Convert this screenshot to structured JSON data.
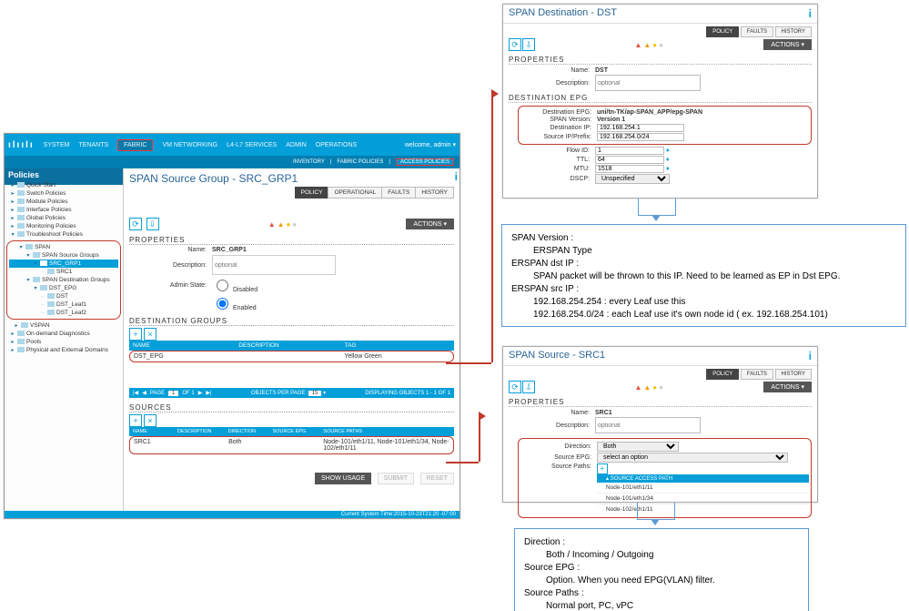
{
  "nav": {
    "system": "SYSTEM",
    "tenants": "TENANTS",
    "fabric": "FABRIC",
    "vm": "VM NETWORKING",
    "l4l7": "L4-L7 SERVICES",
    "admin": "ADMIN",
    "ops": "OPERATIONS",
    "user": "welcome, admin ▾"
  },
  "subnav": {
    "inv": "INVENTORY",
    "fp": "FABRIC POLICIES",
    "ap": "ACCESS POLICIES"
  },
  "tree": {
    "hdr": "Policies",
    "items": [
      "Quick Start",
      "Switch Policies",
      "Module Policies",
      "Interface Policies",
      "Global Policies",
      "Monitoring Policies",
      "Troubleshoot Policies"
    ],
    "span": "SPAN",
    "ssg": "SPAN Source Groups",
    "srcgrp": "SRC_GRP1",
    "src1": "SRC1",
    "sdg": "SPAN Destination Groups",
    "dstepg": "DST_EPG",
    "dst": "DST",
    "dstl1": "DST_Leaf1",
    "dstl2": "DST_Leaf2",
    "vspan": "VSPAN",
    "ond": "On-demand Diagnostics",
    "pools": "Pools",
    "phys": "Physical and External Domains"
  },
  "main": {
    "title": "SPAN Source Group - SRC_GRP1",
    "tabs": {
      "policy": "POLICY",
      "oper": "OPERATIONAL",
      "faults": "FAULTS",
      "history": "HISTORY"
    },
    "actions": "ACTIONS ▾",
    "props_hdr": "PROPERTIES",
    "name_lbl": "Name:",
    "name_val": "SRC_GRP1",
    "desc_lbl": "Description:",
    "desc_ph": "optional",
    "admin_lbl": "Admin State:",
    "admin_dis": "Disabled",
    "admin_en": "Enabled",
    "dest_hdr": "DESTINATION GROUPS",
    "dest_cols": {
      "name": "NAME",
      "desc": "DESCRIPTION",
      "tag": "TAG"
    },
    "dest_row": {
      "name": "DST_EPG",
      "tag": "Yellow Green"
    },
    "pager": {
      "page_lbl": "PAGE",
      "page": "1",
      "of": "OF 1",
      "opp": "OBJECTS PER PAGE:",
      "oppv": "15",
      "disp": "DISPLAYING OBJECTS 1 - 1 OF 1"
    },
    "src_hdr": "SOURCES",
    "src_cols": {
      "name": "NAME",
      "desc": "DESCRIPTION",
      "dir": "DIRECTION",
      "sepg": "SOURCE EPG",
      "paths": "SOURCE PATHS"
    },
    "src_row": {
      "name": "SRC1",
      "dir": "Both",
      "paths": "Node-101/eth1/11, Node-101/eth1/34, Node-102/eth1/11"
    },
    "show": "SHOW USAGE",
    "submit": "SUBMIT",
    "reset": "RESET",
    "systime": "Current System Time:2015-10-23T21:20 -07:00"
  },
  "dst": {
    "title": "SPAN Destination - DST",
    "tabs": {
      "policy": "POLICY",
      "faults": "FAULTS",
      "history": "HISTORY"
    },
    "actions": "ACTIONS ▾",
    "props": "PROPERTIES",
    "name_lbl": "Name:",
    "name_val": "DST",
    "desc_lbl": "Description:",
    "desc_ph": "optional",
    "depg_hdr": "DESTINATION EPG",
    "depg_lbl": "Destination EPG:",
    "depg_val": "uni/tn-TK/ap-SPAN_APP/epg-SPAN",
    "ver_lbl": "SPAN Version:",
    "ver_val": "Version 1",
    "dip_lbl": "Destination IP:",
    "dip_val": "192.168.254.1",
    "sip_lbl": "Source IP/Prefix:",
    "sip_val": "192.168.254.0/24",
    "flow_lbl": "Flow ID:",
    "flow_val": "1",
    "ttl_lbl": "TTL:",
    "ttl_val": "64",
    "mtu_lbl": "MTU:",
    "mtu_val": "1518",
    "dscp_lbl": "DSCP:",
    "dscp_val": "Unspecified"
  },
  "src": {
    "title": "SPAN Source - SRC1",
    "tabs": {
      "policy": "POLICY",
      "faults": "FAULTS",
      "history": "HISTORY"
    },
    "actions": "ACTIONS ▾",
    "props": "PROPERTIES",
    "name_lbl": "Name:",
    "name_val": "SRC1",
    "desc_lbl": "Description:",
    "desc_ph": "optional",
    "dir_lbl": "Direction:",
    "dir_val": "Both",
    "sepg_lbl": "Source EPG:",
    "sepg_val": "select an option",
    "sap_lbl": "Source Paths:",
    "sap_hdr": "SOURCE ACCESS PATH",
    "paths": [
      "Node-101/eth1/11",
      "Node-101/eth1/34",
      "Node-102/eth1/11"
    ]
  },
  "exp1": {
    "l1": "SPAN Version :",
    "l2": "ERSPAN Type",
    "l3": "ERSPAN dst IP :",
    "l4": "SPAN packet will be thrown to this IP. Need to be learned as EP in Dst EPG.",
    "l5": "ERSPAN src IP :",
    "l6": "192.168.254.254 : every Leaf use this",
    "l7": "192.168.254.0/24 : each Leaf use it's own node id ( ex. 192.168.254.101)"
  },
  "exp2": {
    "l1": "Direction :",
    "l2": "Both / Incoming / Outgoing",
    "l3": "Source EPG :",
    "l4": "Option. When you need EPG(VLAN) filter.",
    "l5": "Source Paths :",
    "l6": "Normal port, PC, vPC"
  }
}
